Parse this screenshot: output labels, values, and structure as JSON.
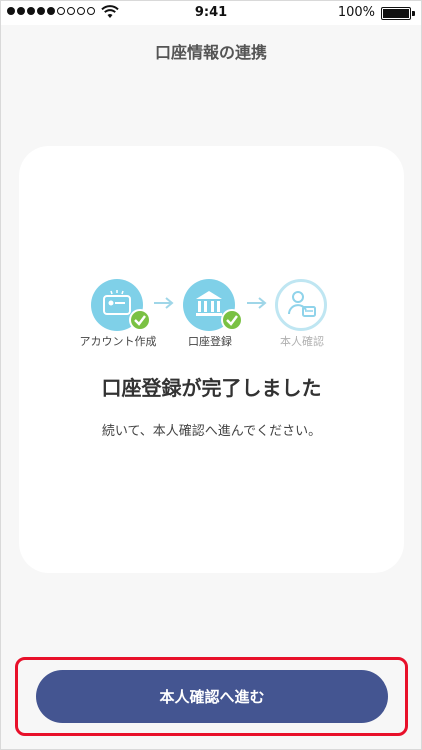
{
  "status_bar": {
    "time": "9:41",
    "battery": "100%"
  },
  "header": {
    "title": "口座情報の連携"
  },
  "card": {
    "steps": [
      {
        "label": "アカウント作成",
        "icon": "card-icon",
        "done": true
      },
      {
        "label": "口座登録",
        "icon": "bank-icon",
        "done": true
      },
      {
        "label": "本人確認",
        "icon": "identity-icon",
        "done": false
      }
    ],
    "headline": "口座登録が完了しました",
    "subtext": "続いて、本人確認へ進んでください。"
  },
  "footer": {
    "primary_button_label": "本人確認へ進む"
  },
  "colors": {
    "step_fill": "#7fd0e8",
    "check": "#7ac143",
    "button": "#445591",
    "highlight": "#e8102a"
  }
}
